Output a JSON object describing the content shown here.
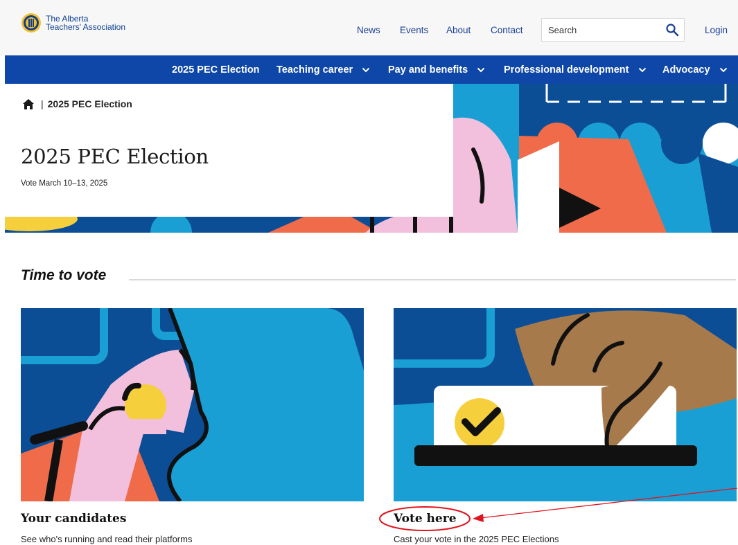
{
  "header": {
    "logo_line1": "The Alberta",
    "logo_line2": "Teachers' Association",
    "utility_links": [
      "News",
      "Events",
      "About",
      "Contact"
    ],
    "search_placeholder": "Search",
    "login_label": "Login"
  },
  "nav": {
    "items": [
      {
        "label": "2025 PEC Election",
        "has_dropdown": false
      },
      {
        "label": "Teaching career",
        "has_dropdown": true
      },
      {
        "label": "Pay and benefits",
        "has_dropdown": true
      },
      {
        "label": "Professional development",
        "has_dropdown": true
      },
      {
        "label": "Advocacy",
        "has_dropdown": true
      }
    ]
  },
  "hero": {
    "breadcrumb_current": "2025 PEC Election",
    "title": "2025 PEC Election",
    "subtitle": "Vote March 10–13, 2025"
  },
  "section": {
    "heading": "Time to vote"
  },
  "cards": [
    {
      "title": "Your candidates",
      "description": "See who's running and read their platforms"
    },
    {
      "title": "Vote here",
      "description": "Cast your vote in the 2025 PEC Elections"
    }
  ],
  "colors": {
    "nav_blue": "#0e47a8",
    "link_blue": "#1b3f95",
    "art_sky": "#1a9fd4",
    "art_navy": "#0b4e96",
    "art_coral": "#ef6b4a",
    "art_pink": "#f2bfdc",
    "art_yellow": "#f6cf3c",
    "art_brown": "#a77a4c",
    "annotation_red": "#e0141e"
  },
  "icons": {
    "home": "home-icon",
    "search": "search-icon",
    "dropdown": "chevron-down-icon"
  }
}
